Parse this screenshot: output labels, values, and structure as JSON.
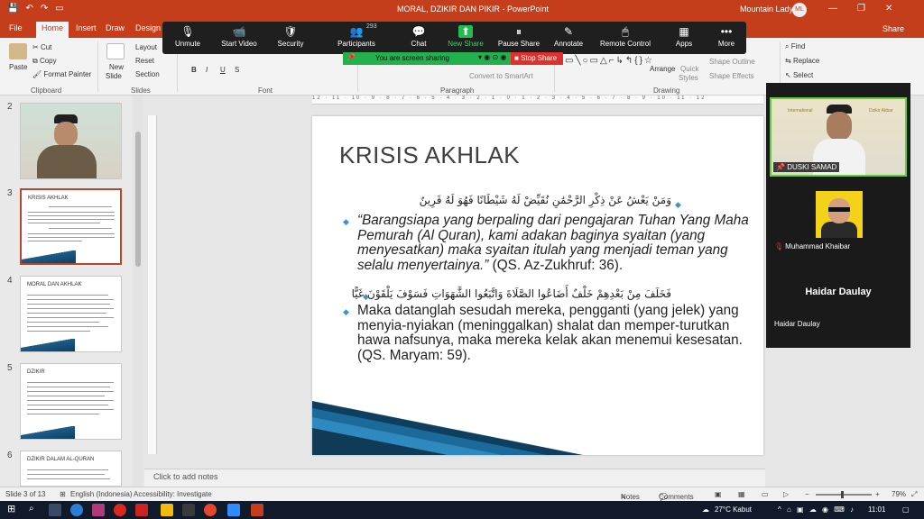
{
  "titlebar": {
    "doc_title": "MORAL, DZIKIR DAN PIKIR  -  PowerPoint",
    "user": "Mountain Lady",
    "initials": "ML"
  },
  "tabs": [
    "File",
    "Home",
    "Insert",
    "Draw",
    "Design"
  ],
  "share_label": "Share",
  "ribbon": {
    "paste": "Paste",
    "cut": "Cut",
    "copy": "Copy",
    "format_painter": "Format Painter",
    "clipboard": "Clipboard",
    "new_slide_1": "New",
    "new_slide_2": "Slide",
    "layout": "Layout",
    "reset": "Reset",
    "section": "Section",
    "slides": "Slides",
    "font": "Font",
    "paragraph": "Paragraph",
    "convert": "Convert to SmartArt",
    "arrange": "Arrange",
    "quick_styles_1": "Quick",
    "quick_styles_2": "Styles",
    "shape_outline": "Shape Outline",
    "shape_effects": "Shape Effects",
    "drawing": "Drawing",
    "find": "Find",
    "replace": "Replace",
    "select": "Select"
  },
  "zoom": {
    "participants_count": "293",
    "buttons": [
      {
        "label": "Unmute",
        "icon": "🎙"
      },
      {
        "label": "Start Video",
        "icon": "📹"
      },
      {
        "label": "Security",
        "icon": "🛡"
      },
      {
        "label": "Participants",
        "icon": "👥"
      },
      {
        "label": "Chat",
        "icon": "💬"
      },
      {
        "label": "New Share",
        "icon": "⬆"
      },
      {
        "label": "Pause Share",
        "icon": "⏸"
      },
      {
        "label": "Annotate",
        "icon": "✎"
      },
      {
        "label": "Remote Control",
        "icon": "🖱"
      },
      {
        "label": "Apps",
        "icon": "▦"
      },
      {
        "label": "More",
        "icon": "•••"
      }
    ],
    "sharing_text": "You are screen sharing",
    "stop_share": "Stop Share"
  },
  "thumbnails": [
    {
      "num": "2"
    },
    {
      "num": "3",
      "title": "KRISIS AKHLAK"
    },
    {
      "num": "4",
      "title": "MORAL DAN AKHLAK"
    },
    {
      "num": "5",
      "title": "DZIKIR"
    },
    {
      "num": "6",
      "title": "DZIKIR DALAM AL-QURAN"
    }
  ],
  "slide": {
    "title": "KRISIS AKHLAK",
    "arabic_1": "وَمَنْ يَعْشُ عَنْ ذِكْرِ الرَّحْمَٰنِ نُقَيِّضْ لَهُ شَيْطَانًا فَهُوَ لَهُ قَرِينٌ",
    "body_1": "“Barangsiapa yang berpaling dari pengajaran Tuhan Yang Maha Pemurah (Al Quran), kami adakan baginya syaitan (yang menyesatkan) maka syaitan itulah yang menjadi teman yang selalu menyertainya.”",
    "body_1_ref": " (QS. Az-Zukhruf: 36).",
    "arabic_2": "فَخَلَفَ مِنْ بَعْدِهِمْ خَلْفٌ أَضَاعُوا الصَّلَاةَ وَاتَّبَعُوا الشَّهَوَاتِ فَسَوْفَ يَلْقَوْنَ غَيًّا",
    "body_2": "Maka datanglah sesudah mereka, pengganti (yang jelek) yang menyia-nyiakan (meninggalkan) shalat dan memper-turutkan hawa nafsunya, maka mereka kelak akan menemui kesesatan. (QS. Maryam: 59)."
  },
  "notes_placeholder": "Click to add notes",
  "status": {
    "slide_of": "Slide 3 of 13",
    "language": "English (Indonesia)",
    "accessibility": "Accessibility: Investigate",
    "notes": "Notes",
    "comments": "Comments",
    "zoom": "79%"
  },
  "participants": [
    {
      "name": "DUSKI SAMAD"
    },
    {
      "name": "Muhammad Khaibar"
    },
    {
      "name": "Haidar Daulay",
      "display": "Haidar Daulay"
    }
  ],
  "taskbar": {
    "weather": "27°C  Kabut",
    "time": "11:01"
  },
  "colors": {
    "accent": "#c43e1c",
    "zoom_green": "#23b14d",
    "stop_red": "#e0302d",
    "bullet": "#3b93d6"
  }
}
